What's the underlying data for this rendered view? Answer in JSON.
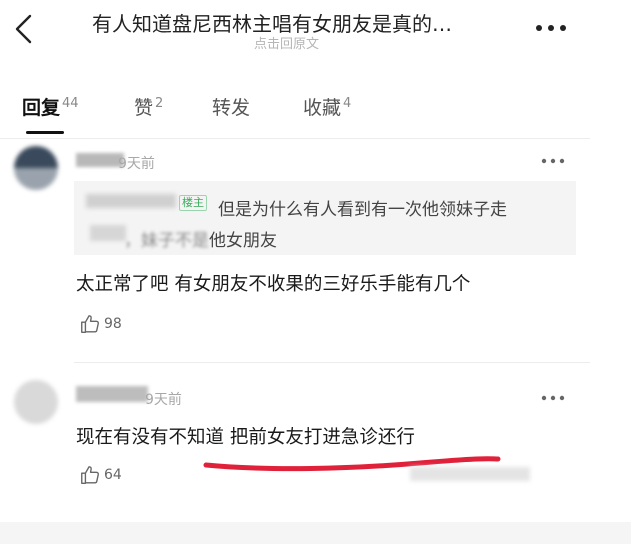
{
  "header": {
    "title": "有人知道盘尼西林主唱有女朋友是真的…",
    "subtitle": "点击回原文"
  },
  "tabs": [
    {
      "label": "回复",
      "count": "44",
      "active": true
    },
    {
      "label": "赞",
      "count": "2"
    },
    {
      "label": "转发",
      "count": ""
    },
    {
      "label": "收藏",
      "count": "4"
    }
  ],
  "comments": [
    {
      "time": "9天前",
      "quote": {
        "badge": "楼主",
        "line1": "但是为什么有人看到有一次他领妹子走",
        "line2_blurred": "，妹子不是",
        "line2": "他女朋友"
      },
      "text": "太正常了吧 有女朋友不收果的三好乐手能有几个",
      "likes": "98"
    },
    {
      "time": "9天前",
      "text": "现在有没有不知道 把前女友打进急诊还行",
      "likes": "64"
    }
  ],
  "colors": {
    "op_badge": "#3aaa5b",
    "annotation_underline": "#e0213a"
  },
  "icons": [
    "back-arrow-icon",
    "more-icon",
    "thumb-up-icon"
  ]
}
